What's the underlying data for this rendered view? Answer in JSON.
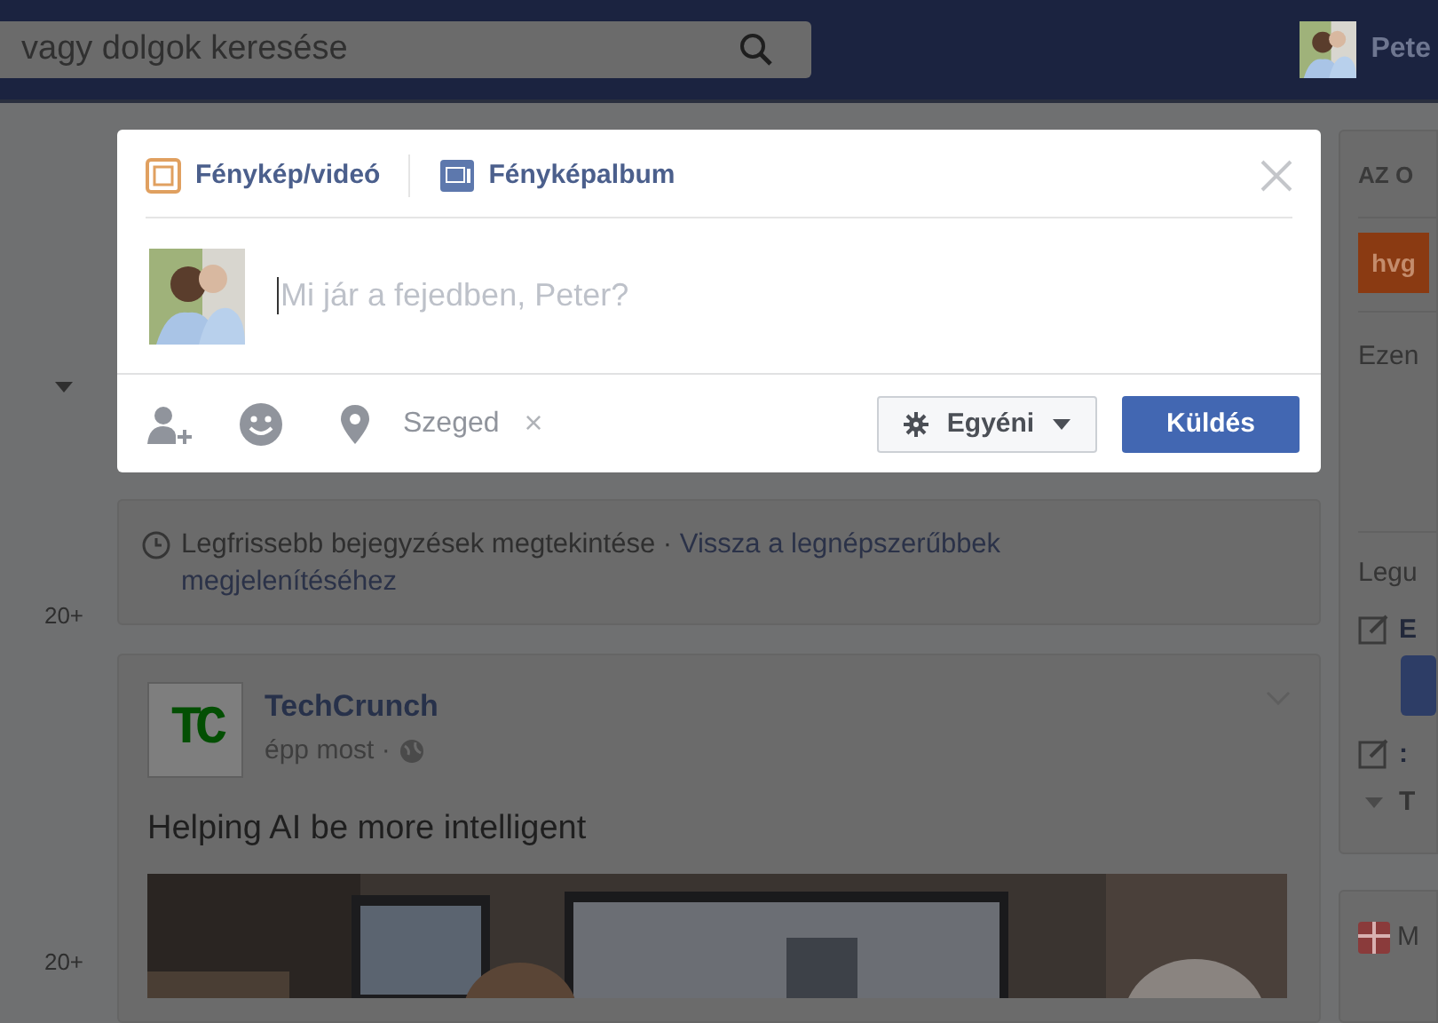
{
  "top_bar": {
    "search": {
      "placeholder": "vagy dolgok keresése"
    },
    "user": {
      "name": "Pete"
    }
  },
  "left_rail": {
    "counts": [
      "20+",
      "20+"
    ]
  },
  "composer": {
    "tabs": [
      {
        "label": "Fénykép/videó"
      },
      {
        "label": "Fényképalbum",
        "kind": "album"
      }
    ],
    "placeholder": "Mi jár a fejedben, Peter?",
    "location": "Szeged",
    "location_remove": "×",
    "privacy": "Egyéni",
    "submit": "Küldés"
  },
  "feed": {
    "notice": {
      "text": "Legfrissebb bejegyzések megtekintése ·",
      "link": "Vissza a legnépszerűbbek megjelenítéséhez"
    },
    "post": {
      "logo": "TC",
      "author": "TechCrunch",
      "time": "épp most ·",
      "text": "Helping AI be more intelligent"
    }
  },
  "right_column": {
    "title": "AZ O",
    "logo": "hvg",
    "label": "Ezen",
    "section": "Legu",
    "items": [
      {
        "kind": "edit",
        "text": "E"
      },
      {
        "kind": "button"
      },
      {
        "kind": "edit",
        "text": ":"
      },
      {
        "kind": "caret",
        "text": "T"
      }
    ],
    "second_panel": {
      "text": "M"
    }
  }
}
